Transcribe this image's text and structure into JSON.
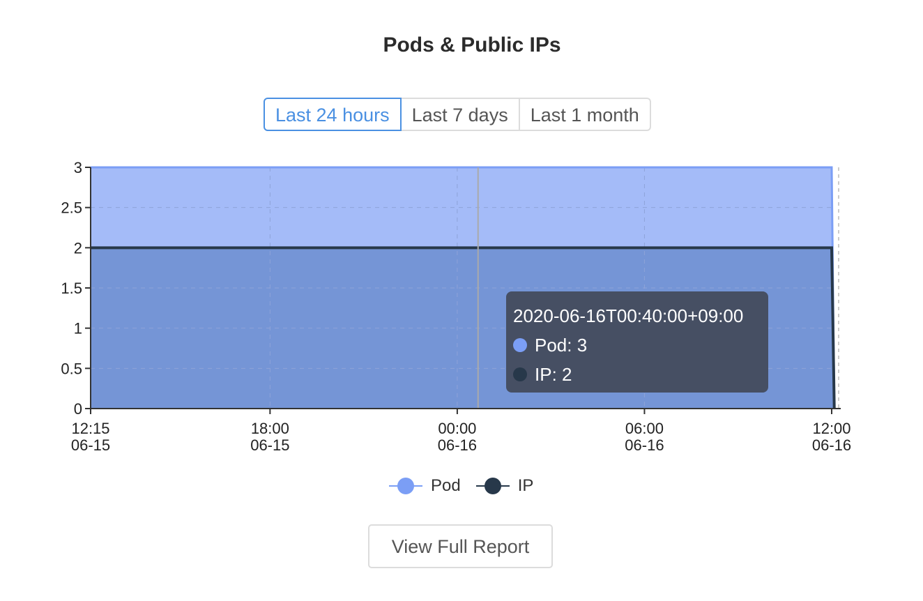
{
  "title": "Pods & Public IPs",
  "range_buttons": [
    {
      "label": "Last 24 hours",
      "active": true
    },
    {
      "label": "Last 7 days",
      "active": false
    },
    {
      "label": "Last 1 month",
      "active": false
    }
  ],
  "colors": {
    "pod": "#7b9ef5",
    "ip": "#27384a",
    "active": "#4a90e2"
  },
  "chart_data": {
    "type": "area",
    "ylim": [
      0,
      3
    ],
    "y_ticks": [
      "0",
      "0.5",
      "1",
      "1.5",
      "2",
      "2.5",
      "3"
    ],
    "x_ticks": [
      {
        "time": "12:15",
        "date": "06-15"
      },
      {
        "time": "18:00",
        "date": "06-15"
      },
      {
        "time": "00:00",
        "date": "06-16"
      },
      {
        "time": "06:00",
        "date": "06-16"
      },
      {
        "time": "12:00",
        "date": "06-16"
      }
    ],
    "series": [
      {
        "name": "Pod",
        "x": [
          "2020-06-15T12:15:00+09:00",
          "2020-06-16T12:00:00+09:00",
          "2020-06-16T12:05:00+09:00"
        ],
        "values": [
          3,
          3,
          0
        ]
      },
      {
        "name": "IP",
        "x": [
          "2020-06-15T12:15:00+09:00",
          "2020-06-16T12:00:00+09:00",
          "2020-06-16T12:05:00+09:00"
        ],
        "values": [
          2,
          2,
          0
        ]
      }
    ]
  },
  "tooltip": {
    "timestamp": "2020-06-16T00:40:00+09:00",
    "pod": "Pod: 3",
    "ip": "IP: 2"
  },
  "legend": {
    "pod": "Pod",
    "ip": "IP"
  },
  "report_button": "View Full Report"
}
